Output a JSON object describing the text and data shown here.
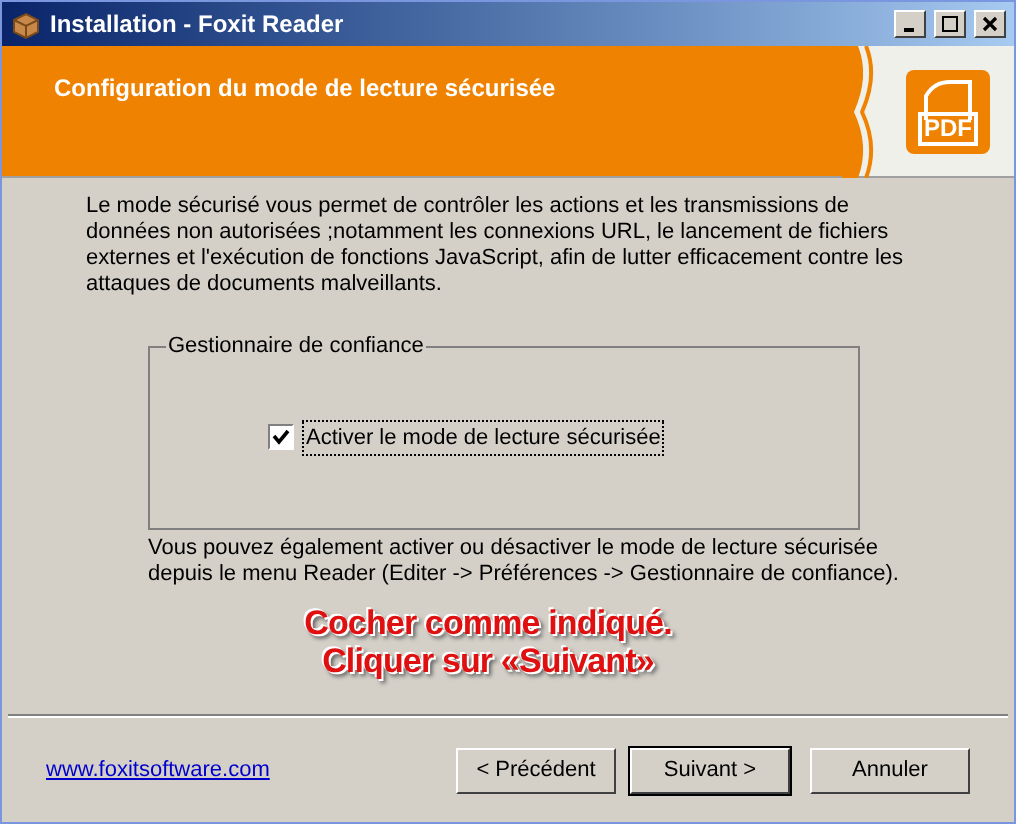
{
  "window": {
    "title": "Installation - Foxit Reader"
  },
  "header": {
    "title": "Configuration du mode de lecture sécurisée",
    "logo_text": "PDF"
  },
  "description": "Le mode sécurisé vous permet de contrôler les actions et les transmissions de données non autorisées ;notamment les connexions URL, le lancement de fichiers externes et l'exécution de fonctions JavaScript, afin de lutter efficacement contre les attaques de documents malveillants.",
  "group": {
    "title": "Gestionnaire de confiance",
    "checkbox": {
      "label": "Activer le mode de lecture sécurisée",
      "checked": true
    }
  },
  "note": "Vous pouvez également activer ou désactiver le mode de lecture sécurisée depuis le menu Reader (Editer -> Préférences -> Gestionnaire de confiance).",
  "annotation": [
    "Cocher comme indiqué.",
    "Cliquer sur «Suivant»"
  ],
  "footer": {
    "link": "www.foxitsoftware.com",
    "buttons": [
      {
        "label": "< Précédent",
        "default": false
      },
      {
        "label": "Suivant >",
        "default": true
      },
      {
        "label": "Annuler",
        "default": false
      }
    ]
  }
}
